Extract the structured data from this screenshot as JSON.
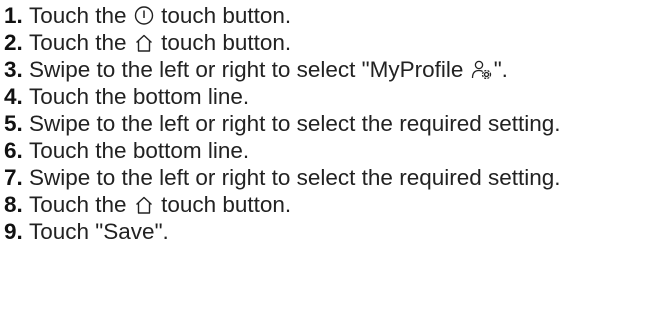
{
  "steps": [
    {
      "number": "1.",
      "before": "Touch the ",
      "icon": "power-icon",
      "after": " touch button."
    },
    {
      "number": "2.",
      "before": "Touch the ",
      "icon": "home-icon",
      "after": " touch button."
    },
    {
      "number": "3.",
      "before": "Swipe to the left or right to select \"MyProfile ",
      "icon": "user-settings-icon",
      "after": "\"."
    },
    {
      "number": "4.",
      "text": "Touch the bottom line."
    },
    {
      "number": "5.",
      "text": "Swipe to the left or right to select the required setting."
    },
    {
      "number": "6.",
      "text": "Touch the bottom line."
    },
    {
      "number": "7.",
      "text": "Swipe to the left or right to select the required setting."
    },
    {
      "number": "8.",
      "before": "Touch the ",
      "icon": "home-icon",
      "after": " touch button."
    },
    {
      "number": "9.",
      "text": "Touch \"Save\"."
    }
  ]
}
